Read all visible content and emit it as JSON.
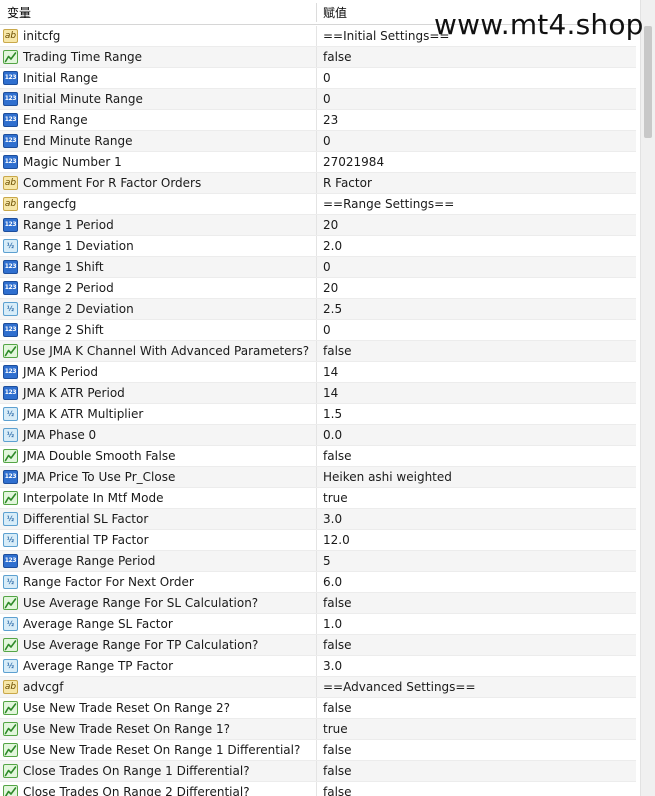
{
  "header": {
    "variable_label": "变量",
    "value_label": "赋值"
  },
  "watermark": "www.mt4.shop",
  "colors": {
    "alt_row": "#f5f5f5",
    "grid": "#ececec"
  },
  "rows": [
    {
      "icon": "ab",
      "name": "initcfg",
      "value": "==Initial Settings=="
    },
    {
      "icon": "bool",
      "name": "Trading Time Range",
      "value": "false"
    },
    {
      "icon": "num",
      "name": "Initial Range",
      "value": "0"
    },
    {
      "icon": "num",
      "name": "Initial Minute Range",
      "value": "0"
    },
    {
      "icon": "num",
      "name": "End Range",
      "value": "23"
    },
    {
      "icon": "num",
      "name": "End Minute Range",
      "value": "0"
    },
    {
      "icon": "num",
      "name": "Magic Number 1",
      "value": "27021984"
    },
    {
      "icon": "ab",
      "name": "Comment For R Factor Orders",
      "value": "R Factor"
    },
    {
      "icon": "ab",
      "name": "rangecfg",
      "value": "==Range Settings=="
    },
    {
      "icon": "num",
      "name": "Range 1 Period",
      "value": "20"
    },
    {
      "icon": "dbl",
      "name": "Range 1 Deviation",
      "value": "2.0"
    },
    {
      "icon": "num",
      "name": "Range 1 Shift",
      "value": "0"
    },
    {
      "icon": "num",
      "name": "Range 2 Period",
      "value": "20"
    },
    {
      "icon": "dbl",
      "name": "Range 2 Deviation",
      "value": "2.5"
    },
    {
      "icon": "num",
      "name": "Range 2 Shift",
      "value": "0"
    },
    {
      "icon": "bool",
      "name": "Use JMA K Channel With Advanced Parameters?",
      "value": "false"
    },
    {
      "icon": "num",
      "name": "JMA K Period",
      "value": "14"
    },
    {
      "icon": "num",
      "name": "JMA K ATR Period",
      "value": "14"
    },
    {
      "icon": "dbl",
      "name": "JMA K ATR Multiplier",
      "value": "1.5"
    },
    {
      "icon": "dbl",
      "name": "JMA Phase 0",
      "value": "0.0"
    },
    {
      "icon": "bool",
      "name": "JMA Double Smooth False",
      "value": "false"
    },
    {
      "icon": "num",
      "name": "JMA Price To Use Pr_Close",
      "value": "Heiken ashi weighted"
    },
    {
      "icon": "bool",
      "name": "Interpolate In Mtf Mode",
      "value": "true"
    },
    {
      "icon": "dbl",
      "name": "Differential SL Factor",
      "value": "3.0"
    },
    {
      "icon": "dbl",
      "name": "Differential TP Factor",
      "value": "12.0"
    },
    {
      "icon": "num",
      "name": "Average Range Period",
      "value": "5"
    },
    {
      "icon": "dbl",
      "name": "Range Factor For Next Order",
      "value": "6.0"
    },
    {
      "icon": "bool",
      "name": "Use Average Range For SL Calculation?",
      "value": "false"
    },
    {
      "icon": "dbl",
      "name": "Average Range SL Factor",
      "value": "1.0"
    },
    {
      "icon": "bool",
      "name": "Use Average Range For TP Calculation?",
      "value": "false"
    },
    {
      "icon": "dbl",
      "name": "Average Range TP Factor",
      "value": "3.0"
    },
    {
      "icon": "ab",
      "name": "advcgf",
      "value": "==Advanced Settings=="
    },
    {
      "icon": "bool",
      "name": "Use New Trade Reset On Range 2?",
      "value": "false"
    },
    {
      "icon": "bool",
      "name": "Use New Trade Reset On Range 1?",
      "value": "true"
    },
    {
      "icon": "bool",
      "name": "Use New Trade Reset On Range 1 Differential?",
      "value": "false"
    },
    {
      "icon": "bool",
      "name": "Close Trades On Range 1 Differential?",
      "value": "false"
    },
    {
      "icon": "bool",
      "name": "Close Trades On Range 2 Differential?",
      "value": "false"
    }
  ]
}
